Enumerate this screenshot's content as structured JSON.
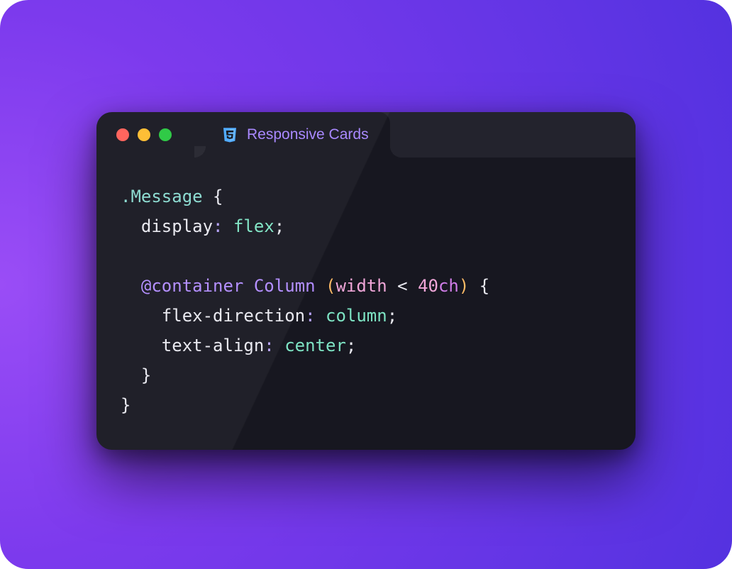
{
  "window": {
    "tab_label": "Responsive Cards",
    "tab_icon": "css3-icon"
  },
  "code": {
    "line1": {
      "selector": ".Message",
      "brace_open": " {"
    },
    "line2": {
      "indent": 1,
      "prop": "display",
      "colon": ":",
      "space": " ",
      "value": "flex",
      "semi": ";"
    },
    "line3_blank": "",
    "line4": {
      "indent": 1,
      "at": "@container",
      "space1": " ",
      "cname": "Column",
      "space2": " ",
      "po": "(",
      "cond": "width",
      "space3": " ",
      "op": "<",
      "space4": " ",
      "num": "40",
      "unit": "ch",
      "pc": ")",
      "brace": " {"
    },
    "line5": {
      "indent": 2,
      "prop": "flex-direction",
      "colon": ":",
      "space": " ",
      "value": "column",
      "semi": ";"
    },
    "line6": {
      "indent": 2,
      "prop": "text-align",
      "colon": ":",
      "space": " ",
      "value": "center",
      "semi": ";"
    },
    "line7": {
      "indent": 1,
      "brace_close": "}"
    },
    "line8": {
      "brace_close": "}"
    }
  }
}
